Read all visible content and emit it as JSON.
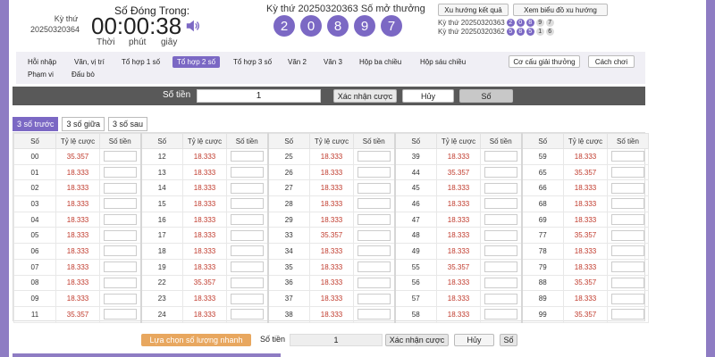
{
  "header": {
    "kythu_label": "Kỳ thứ",
    "kythu_value": "20250320364",
    "closing_label": "Số Đóng Trong:",
    "timer": "00:00:38",
    "unit_hour": "Thời",
    "unit_min": "phút",
    "unit_sec": "giây",
    "draw_label": "Kỳ thứ 20250320363   Số mở thưởng",
    "draw_numbers": [
      "2",
      "0",
      "8",
      "9",
      "7"
    ],
    "trend_button": "Xu hướng kết quả",
    "chart_button": "Xem biểu đồ xu hướng",
    "history": [
      {
        "label": "Kỳ thứ 20250320363",
        "numbers": [
          "2",
          "0",
          "8",
          "9",
          "7"
        ]
      },
      {
        "label": "Kỳ thứ 20250320362",
        "numbers": [
          "5",
          "8",
          "5",
          "1",
          "6"
        ]
      }
    ]
  },
  "nav": {
    "items": [
      "Hỗi nhập",
      "Văn, vị trí",
      "Tổ hợp 1 số",
      "Tổ hợp 2 số",
      "Tổ hợp 3 số",
      "Văn 2",
      "Văn 3",
      "Hộp ba chiều",
      "Hộp sáu chiều"
    ],
    "items_row2": [
      "Phạm vi",
      "Đấu bò"
    ],
    "active": "Tổ hợp 2 số",
    "prize_button": "Cơ cấu giải thưởng",
    "howto_button": "Cách chơi"
  },
  "amount_bar": {
    "label": "Số tiền",
    "value": "1",
    "confirm": "Xác nhận cược",
    "cancel": "Hủy",
    "numbers": "Số"
  },
  "tabs": [
    "3 số trước",
    "3 số giữa",
    "3 số sau"
  ],
  "table": {
    "headers": [
      "Số",
      "Tỷ lệ cược",
      "Số tiền"
    ],
    "rows": [
      [
        [
          "00",
          "35.357"
        ],
        [
          "12",
          "18.333"
        ],
        [
          "25",
          "18.333"
        ],
        [
          "39",
          "18.333"
        ],
        [
          "59",
          "18.333"
        ]
      ],
      [
        [
          "01",
          "18.333"
        ],
        [
          "13",
          "18.333"
        ],
        [
          "26",
          "18.333"
        ],
        [
          "44",
          "35.357"
        ],
        [
          "65",
          "35.357"
        ]
      ],
      [
        [
          "02",
          "18.333"
        ],
        [
          "14",
          "18.333"
        ],
        [
          "27",
          "18.333"
        ],
        [
          "45",
          "18.333"
        ],
        [
          "66",
          "18.333"
        ]
      ],
      [
        [
          "03",
          "18.333"
        ],
        [
          "15",
          "18.333"
        ],
        [
          "28",
          "18.333"
        ],
        [
          "46",
          "18.333"
        ],
        [
          "68",
          "18.333"
        ]
      ],
      [
        [
          "04",
          "18.333"
        ],
        [
          "16",
          "18.333"
        ],
        [
          "29",
          "18.333"
        ],
        [
          "47",
          "18.333"
        ],
        [
          "69",
          "18.333"
        ]
      ],
      [
        [
          "05",
          "18.333"
        ],
        [
          "17",
          "18.333"
        ],
        [
          "33",
          "35.357"
        ],
        [
          "48",
          "18.333"
        ],
        [
          "77",
          "35.357"
        ]
      ],
      [
        [
          "06",
          "18.333"
        ],
        [
          "18",
          "18.333"
        ],
        [
          "34",
          "18.333"
        ],
        [
          "49",
          "18.333"
        ],
        [
          "78",
          "18.333"
        ]
      ],
      [
        [
          "07",
          "18.333"
        ],
        [
          "19",
          "18.333"
        ],
        [
          "35",
          "18.333"
        ],
        [
          "55",
          "35.357"
        ],
        [
          "79",
          "18.333"
        ]
      ],
      [
        [
          "08",
          "18.333"
        ],
        [
          "22",
          "35.357"
        ],
        [
          "36",
          "18.333"
        ],
        [
          "56",
          "18.333"
        ],
        [
          "88",
          "35.357"
        ]
      ],
      [
        [
          "09",
          "18.333"
        ],
        [
          "23",
          "18.333"
        ],
        [
          "37",
          "18.333"
        ],
        [
          "57",
          "18.333"
        ],
        [
          "89",
          "18.333"
        ]
      ],
      [
        [
          "11",
          "35.357"
        ],
        [
          "24",
          "18.333"
        ],
        [
          "38",
          "18.333"
        ],
        [
          "58",
          "18.333"
        ],
        [
          "99",
          "35.357"
        ]
      ]
    ]
  },
  "bottom": {
    "quick_select": "Lựa chọn số lượng nhanh",
    "label": "Số tiền",
    "value": "1",
    "confirm": "Xác nhận cược",
    "cancel": "Hủy",
    "numbers": "Số"
  },
  "colors": {
    "accent": "#7b68c4",
    "odds": "#c0392b",
    "quick": "#e8a75f",
    "bar": "#595959"
  },
  "icons": {
    "speaker": "speaker-icon"
  }
}
